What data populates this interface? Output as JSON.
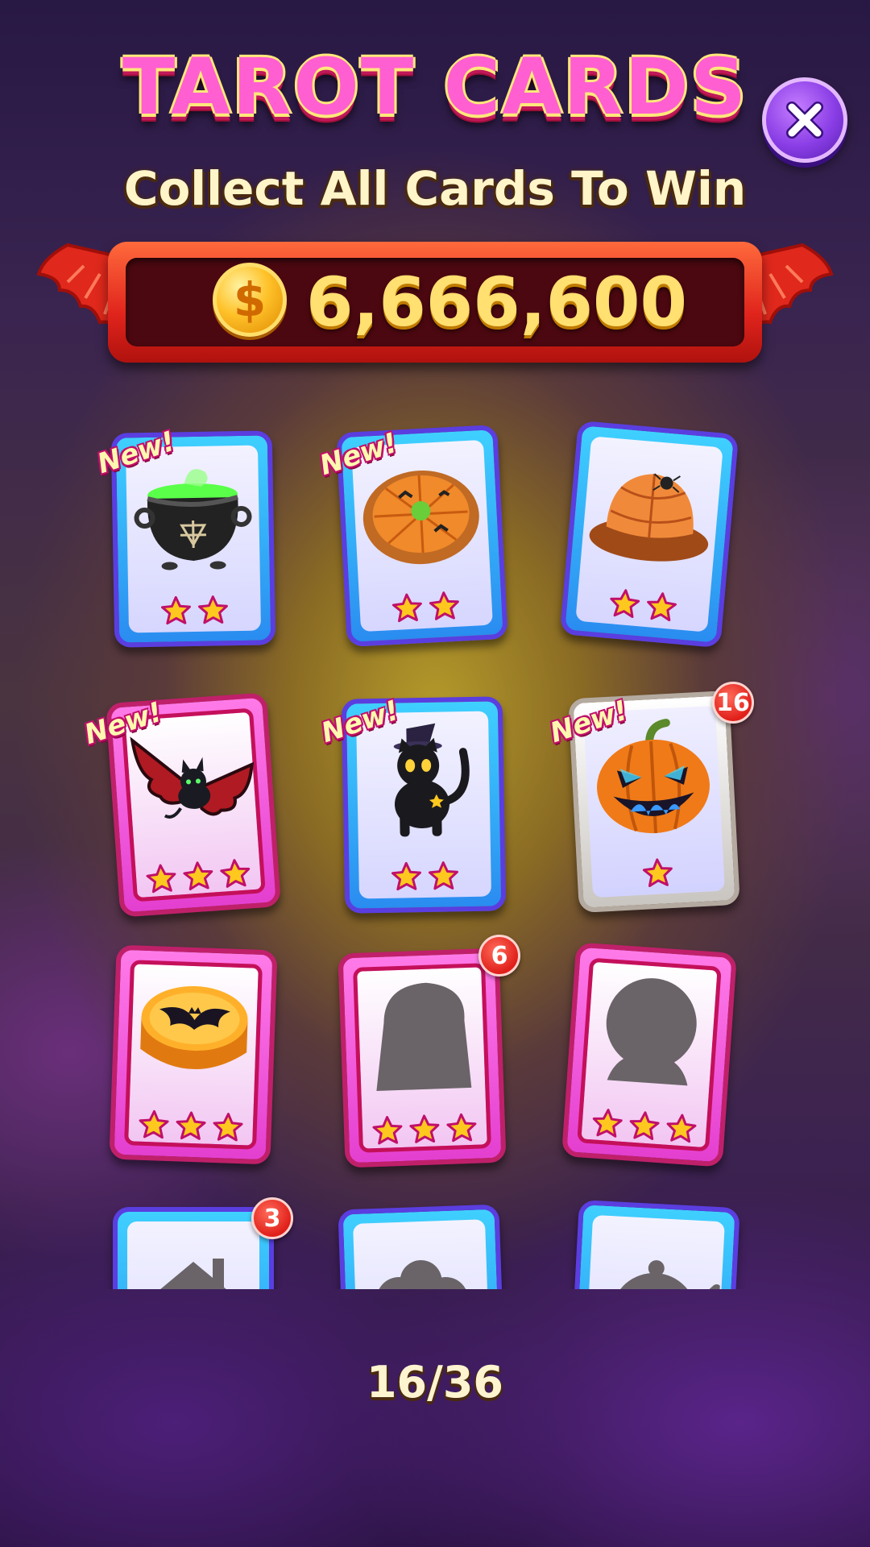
{
  "header": {
    "title": "TAROT CARDS",
    "subtitle": "Collect All Cards To Win"
  },
  "prize": {
    "coin_symbol": "$",
    "amount": "6,666,600"
  },
  "new_label": "New!",
  "cards": [
    {
      "name": "cauldron",
      "frame": "blue",
      "stars": 2,
      "is_new": true,
      "badge": null,
      "collected": true
    },
    {
      "name": "pumpkin-pie",
      "frame": "blue",
      "stars": 2,
      "is_new": true,
      "badge": null,
      "collected": true
    },
    {
      "name": "spiderweb-cake",
      "frame": "blue",
      "stars": 2,
      "is_new": false,
      "badge": null,
      "collected": true
    },
    {
      "name": "bat",
      "frame": "pink",
      "stars": 3,
      "is_new": true,
      "badge": null,
      "collected": true
    },
    {
      "name": "black-cat",
      "frame": "blue",
      "stars": 2,
      "is_new": true,
      "badge": null,
      "collected": true
    },
    {
      "name": "jack-o-lantern",
      "frame": "silver",
      "stars": 1,
      "is_new": true,
      "badge": "16",
      "collected": true
    },
    {
      "name": "bat-jelly",
      "frame": "pink",
      "stars": 3,
      "is_new": false,
      "badge": null,
      "collected": true
    },
    {
      "name": "tombstone",
      "frame": "pink",
      "stars": 3,
      "is_new": false,
      "badge": "6",
      "collected": false
    },
    {
      "name": "crystal-ball",
      "frame": "pink",
      "stars": 3,
      "is_new": false,
      "badge": null,
      "collected": false
    },
    {
      "name": "haunted-house",
      "frame": "blue",
      "stars": 0,
      "is_new": false,
      "badge": "3",
      "collected": false
    },
    {
      "name": "candy",
      "frame": "blue",
      "stars": 0,
      "is_new": false,
      "badge": null,
      "collected": false
    },
    {
      "name": "teapot",
      "frame": "blue",
      "stars": 0,
      "is_new": false,
      "badge": null,
      "collected": false
    }
  ],
  "progress": {
    "text": "16/36",
    "collected": 16,
    "total": 36
  },
  "colors": {
    "title_pink": "#ff5fd1",
    "title_outline": "#ffe97a",
    "prize_gold": "#ffe070",
    "frame_blue": "#3fd0ff",
    "frame_pink": "#ff7ae8",
    "badge_red": "#e0201a",
    "star_gold": "#ffc81e"
  }
}
